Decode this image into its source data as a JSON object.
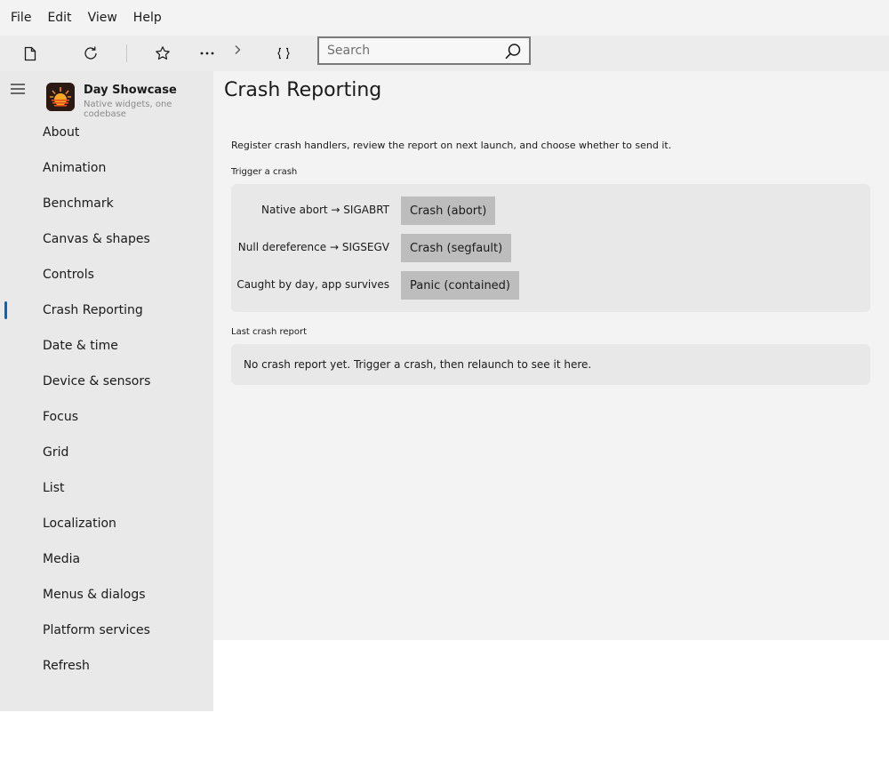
{
  "menubar": {
    "items": [
      "File",
      "Edit",
      "View",
      "Help"
    ]
  },
  "toolbar": {
    "icons": [
      "new-file-icon",
      "refresh-icon",
      "star-icon",
      "more-icon",
      "chevron-right-icon",
      "braces-icon"
    ],
    "search": {
      "placeholder": "Search",
      "value": ""
    }
  },
  "sidebar": {
    "app_title": "Day Showcase",
    "app_subtitle": "Native widgets, one codebase",
    "selected": "Crash Reporting",
    "items": [
      {
        "label": "About"
      },
      {
        "label": "Animation"
      },
      {
        "label": "Benchmark"
      },
      {
        "label": "Canvas & shapes"
      },
      {
        "label": "Controls"
      },
      {
        "label": "Crash Reporting"
      },
      {
        "label": "Date & time"
      },
      {
        "label": "Device & sensors"
      },
      {
        "label": "Focus"
      },
      {
        "label": "Grid"
      },
      {
        "label": "List"
      },
      {
        "label": "Localization"
      },
      {
        "label": "Media"
      },
      {
        "label": "Menus & dialogs"
      },
      {
        "label": "Platform services"
      },
      {
        "label": "Refresh"
      }
    ]
  },
  "main": {
    "title": "Crash Reporting",
    "intro": "Register crash handlers, review the report on next launch, and choose whether to send it.",
    "trigger_section": {
      "label": "Trigger a crash",
      "rows": [
        {
          "label": "Native abort → SIGABRT",
          "button": "Crash (abort)"
        },
        {
          "label": "Null dereference → SIGSEGV",
          "button": "Crash (segfault)"
        },
        {
          "label": "Caught by day, app survives",
          "button": "Panic (contained)"
        }
      ]
    },
    "report_section": {
      "label": "Last crash report",
      "text": "No crash report yet. Trigger a crash, then relaunch to see it here."
    }
  },
  "colors": {
    "accent": "#0067c0",
    "content_bg": "#f3f3f3",
    "sidebar_bg": "#e9e9e9",
    "button_bg": "#bdbdbd"
  }
}
